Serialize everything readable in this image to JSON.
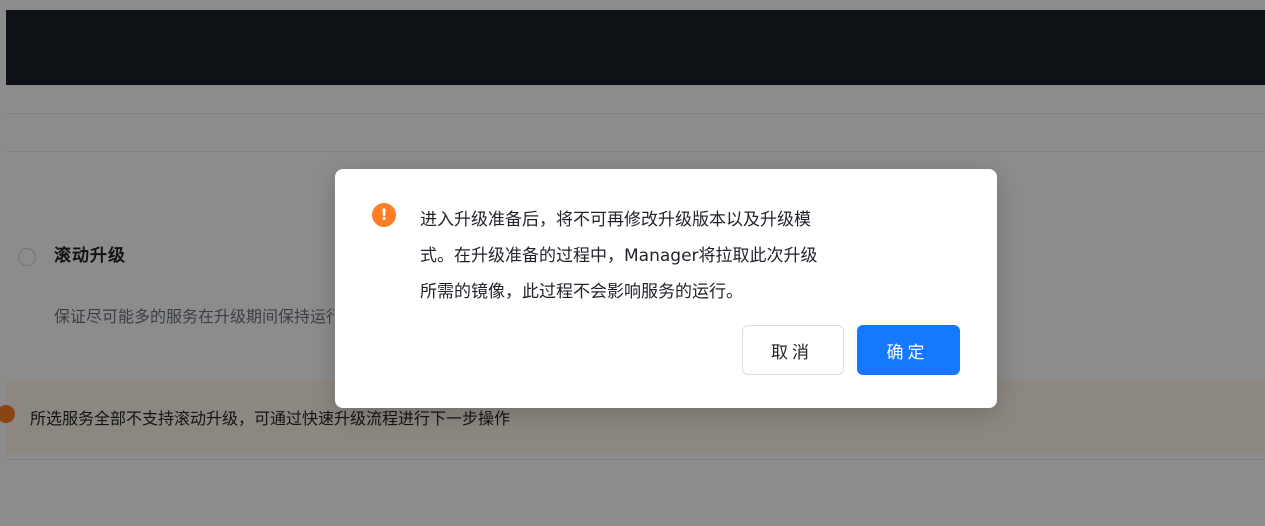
{
  "page": {
    "option": {
      "title": "滚动升级",
      "description": "保证尽可能多的服务在升级期间保持运行"
    },
    "warning": {
      "text": "所选服务全部不支持滚动升级，可通过快速升级流程进行下一步操作"
    }
  },
  "dialog": {
    "icon": "warning-icon",
    "icon_glyph": "!",
    "message_lines": [
      "进入升级准备后，将不可再修改升级版本以及升级模",
      "式。在升级准备的过程中，Manager将拉取此次升级",
      "所需的镜像，此过程不会影响服务的运行。"
    ],
    "cancel_label": "取消",
    "confirm_label": "确定"
  },
  "colors": {
    "top_bar": "#1a1f29",
    "warning": "#ff7d27",
    "primary": "#1677ff",
    "warning_bg": "#fff6ea"
  }
}
